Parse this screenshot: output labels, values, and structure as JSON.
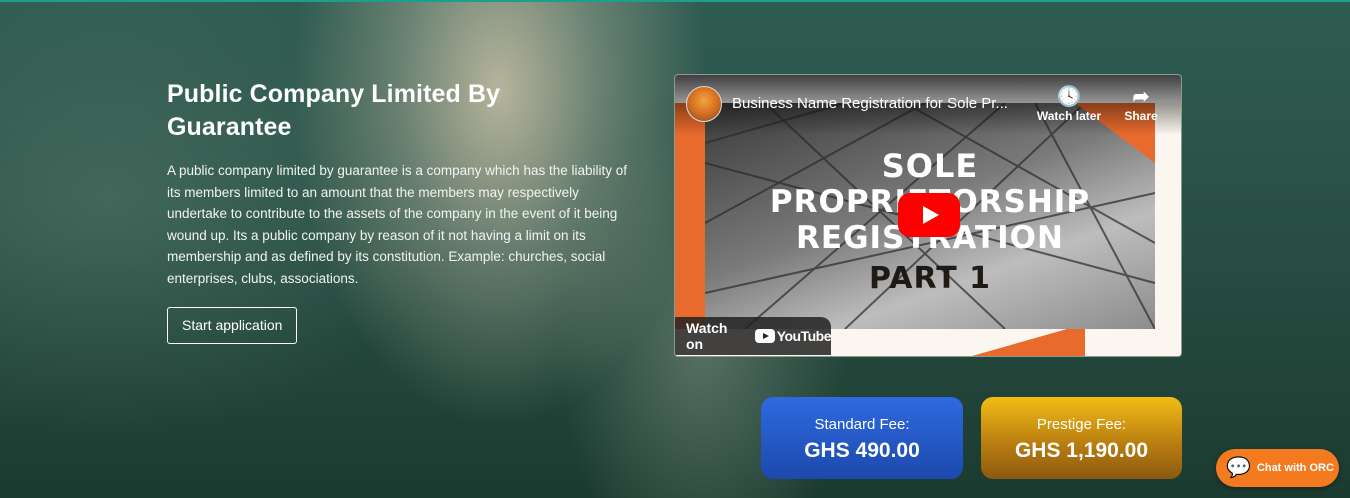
{
  "company": {
    "title": "Public Company Limited By Guarantee",
    "description": "A public company limited by guarantee is a company which has the liability of its members limited to an amount that the members may respectively undertake to contribute to the assets of the company in the event of it being wound up. Its a public company by reason of it not having a limit on its membership and as defined by its constitution. Example: churches, social enterprises, clubs, associations.",
    "start_label": "Start application"
  },
  "video": {
    "title": "Business Name Registration for Sole Pr...",
    "watch_later": "Watch later",
    "share": "Share",
    "watch_on": "Watch on",
    "youtube": "YouTube",
    "thumbnail_lines": [
      "SOLE",
      "PROPRIETORSHIP",
      "REGISTRATION",
      "PART 1"
    ]
  },
  "fees": {
    "standard_label": "Standard Fee:",
    "standard_value": "GHS 490.00",
    "prestige_label": "Prestige Fee:",
    "prestige_value": "GHS 1,190.00"
  },
  "chat": {
    "label": "Chat with ORC",
    "icon": "wechat-icon"
  },
  "colors": {
    "accent_line": "#1aa08c",
    "standard": "#2f6ae0",
    "prestige": "#f2bd15",
    "chat": "#f47a20",
    "youtube_red": "#ff0000"
  }
}
